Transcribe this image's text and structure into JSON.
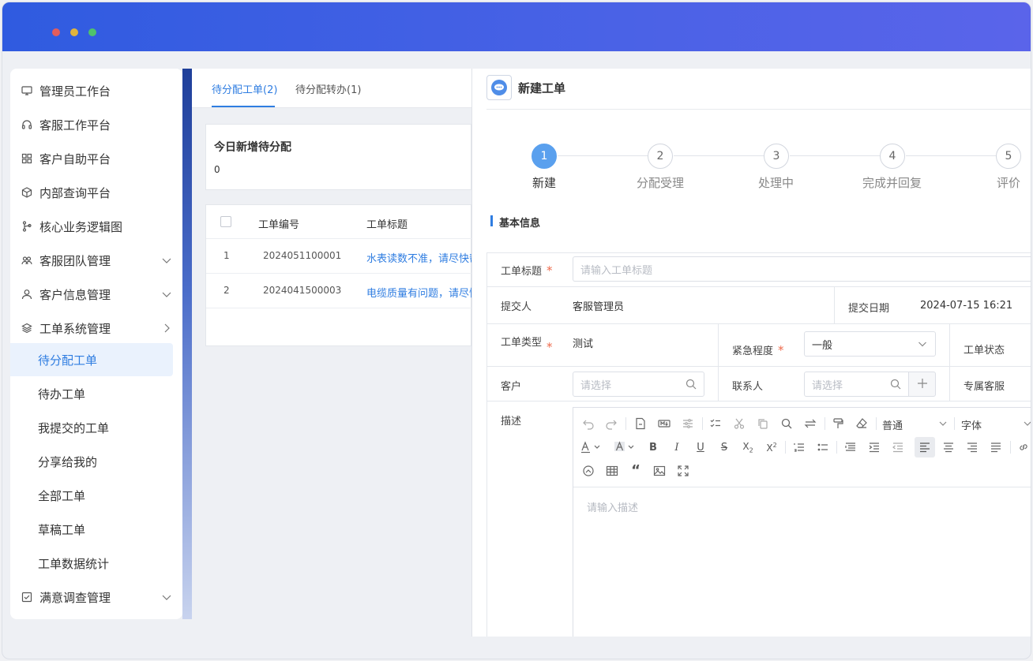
{
  "sidebar": {
    "items": [
      {
        "label": "管理员工作台",
        "icon": "monitor-icon"
      },
      {
        "label": "客服工作平台",
        "icon": "headset-icon"
      },
      {
        "label": "客户自助平台",
        "icon": "grid-icon"
      },
      {
        "label": "内部查询平台",
        "icon": "cube-icon"
      },
      {
        "label": "核心业务逻辑图",
        "icon": "branch-icon"
      },
      {
        "label": "客服团队管理",
        "icon": "team-icon"
      },
      {
        "label": "客户信息管理",
        "icon": "user-icon"
      },
      {
        "label": "工单系统管理",
        "icon": "layers-icon"
      }
    ],
    "sub_items": [
      "待分配工单",
      "待办工单",
      "我提交的工单",
      "分享给我的",
      "全部工单",
      "草稿工单",
      "工单数据统计"
    ],
    "last_item": {
      "label": "满意调查管理",
      "icon": "checkbox-icon"
    }
  },
  "middle": {
    "tabs": [
      "待分配工单(2)",
      "待分配转办(1)"
    ],
    "stat_title": "今日新增待分配",
    "stat_value": "0",
    "table": {
      "headers": [
        "工单编号",
        "工单标题"
      ],
      "rows": [
        {
          "index": "1",
          "code": "2024051100001",
          "title": "水表读数不准，请尽快帮"
        },
        {
          "index": "2",
          "code": "2024041500003",
          "title": "电缆质量有问题，请尽快"
        }
      ]
    }
  },
  "form": {
    "title": "新建工单",
    "steps": [
      {
        "num": "1",
        "label": "新建"
      },
      {
        "num": "2",
        "label": "分配受理"
      },
      {
        "num": "3",
        "label": "处理中"
      },
      {
        "num": "4",
        "label": "完成并回复"
      },
      {
        "num": "5",
        "label": "评价"
      }
    ],
    "section_title": "基本信息",
    "order_title_label": "工单标题",
    "order_title_placeholder": "请输入工单标题",
    "submitter_label": "提交人",
    "submitter_value": "客服管理员",
    "submit_date_label": "提交日期",
    "submit_date_value": "2024-07-15 16:21",
    "type_label": "工单类型",
    "type_value": "测试",
    "urgency_label": "紧急程度",
    "urgency_value": "一般",
    "status_label": "工单状态",
    "customer_label": "客户",
    "customer_placeholder": "请选择",
    "contact_label": "联系人",
    "contact_placeholder": "请选择",
    "exclusive_label": "专属客服",
    "desc_label": "描述",
    "desc_placeholder": "请输入描述",
    "required_mark": "*",
    "editor": {
      "paragraph_select": "普通",
      "font_select": "字体"
    }
  },
  "colors": {
    "accent": "#2f7de1",
    "step_active": "#5aa0ee",
    "required": "#ee6a4c",
    "titlebar_start": "#2f5be0",
    "titlebar_end": "#5a64ea"
  }
}
